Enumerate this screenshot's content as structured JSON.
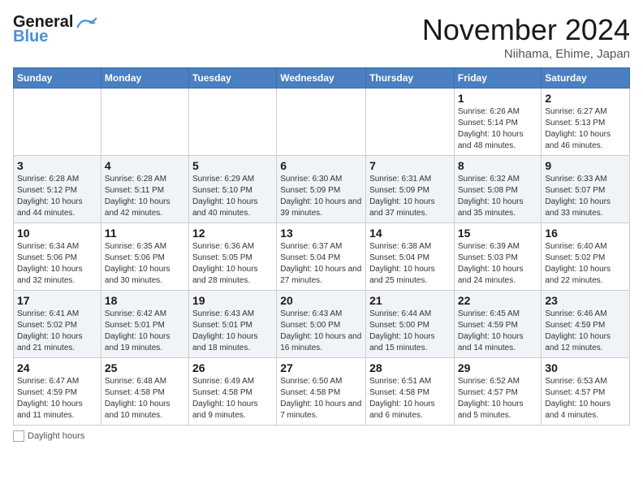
{
  "header": {
    "logo_general": "General",
    "logo_blue": "Blue",
    "month_title": "November 2024",
    "location": "Niihama, Ehime, Japan"
  },
  "weekdays": [
    "Sunday",
    "Monday",
    "Tuesday",
    "Wednesday",
    "Thursday",
    "Friday",
    "Saturday"
  ],
  "weeks": [
    [
      {
        "day": "",
        "info": ""
      },
      {
        "day": "",
        "info": ""
      },
      {
        "day": "",
        "info": ""
      },
      {
        "day": "",
        "info": ""
      },
      {
        "day": "",
        "info": ""
      },
      {
        "day": "1",
        "info": "Sunrise: 6:26 AM\nSunset: 5:14 PM\nDaylight: 10 hours and 48 minutes."
      },
      {
        "day": "2",
        "info": "Sunrise: 6:27 AM\nSunset: 5:13 PM\nDaylight: 10 hours and 46 minutes."
      }
    ],
    [
      {
        "day": "3",
        "info": "Sunrise: 6:28 AM\nSunset: 5:12 PM\nDaylight: 10 hours and 44 minutes."
      },
      {
        "day": "4",
        "info": "Sunrise: 6:28 AM\nSunset: 5:11 PM\nDaylight: 10 hours and 42 minutes."
      },
      {
        "day": "5",
        "info": "Sunrise: 6:29 AM\nSunset: 5:10 PM\nDaylight: 10 hours and 40 minutes."
      },
      {
        "day": "6",
        "info": "Sunrise: 6:30 AM\nSunset: 5:09 PM\nDaylight: 10 hours and 39 minutes."
      },
      {
        "day": "7",
        "info": "Sunrise: 6:31 AM\nSunset: 5:09 PM\nDaylight: 10 hours and 37 minutes."
      },
      {
        "day": "8",
        "info": "Sunrise: 6:32 AM\nSunset: 5:08 PM\nDaylight: 10 hours and 35 minutes."
      },
      {
        "day": "9",
        "info": "Sunrise: 6:33 AM\nSunset: 5:07 PM\nDaylight: 10 hours and 33 minutes."
      }
    ],
    [
      {
        "day": "10",
        "info": "Sunrise: 6:34 AM\nSunset: 5:06 PM\nDaylight: 10 hours and 32 minutes."
      },
      {
        "day": "11",
        "info": "Sunrise: 6:35 AM\nSunset: 5:06 PM\nDaylight: 10 hours and 30 minutes."
      },
      {
        "day": "12",
        "info": "Sunrise: 6:36 AM\nSunset: 5:05 PM\nDaylight: 10 hours and 28 minutes."
      },
      {
        "day": "13",
        "info": "Sunrise: 6:37 AM\nSunset: 5:04 PM\nDaylight: 10 hours and 27 minutes."
      },
      {
        "day": "14",
        "info": "Sunrise: 6:38 AM\nSunset: 5:04 PM\nDaylight: 10 hours and 25 minutes."
      },
      {
        "day": "15",
        "info": "Sunrise: 6:39 AM\nSunset: 5:03 PM\nDaylight: 10 hours and 24 minutes."
      },
      {
        "day": "16",
        "info": "Sunrise: 6:40 AM\nSunset: 5:02 PM\nDaylight: 10 hours and 22 minutes."
      }
    ],
    [
      {
        "day": "17",
        "info": "Sunrise: 6:41 AM\nSunset: 5:02 PM\nDaylight: 10 hours and 21 minutes."
      },
      {
        "day": "18",
        "info": "Sunrise: 6:42 AM\nSunset: 5:01 PM\nDaylight: 10 hours and 19 minutes."
      },
      {
        "day": "19",
        "info": "Sunrise: 6:43 AM\nSunset: 5:01 PM\nDaylight: 10 hours and 18 minutes."
      },
      {
        "day": "20",
        "info": "Sunrise: 6:43 AM\nSunset: 5:00 PM\nDaylight: 10 hours and 16 minutes."
      },
      {
        "day": "21",
        "info": "Sunrise: 6:44 AM\nSunset: 5:00 PM\nDaylight: 10 hours and 15 minutes."
      },
      {
        "day": "22",
        "info": "Sunrise: 6:45 AM\nSunset: 4:59 PM\nDaylight: 10 hours and 14 minutes."
      },
      {
        "day": "23",
        "info": "Sunrise: 6:46 AM\nSunset: 4:59 PM\nDaylight: 10 hours and 12 minutes."
      }
    ],
    [
      {
        "day": "24",
        "info": "Sunrise: 6:47 AM\nSunset: 4:59 PM\nDaylight: 10 hours and 11 minutes."
      },
      {
        "day": "25",
        "info": "Sunrise: 6:48 AM\nSunset: 4:58 PM\nDaylight: 10 hours and 10 minutes."
      },
      {
        "day": "26",
        "info": "Sunrise: 6:49 AM\nSunset: 4:58 PM\nDaylight: 10 hours and 9 minutes."
      },
      {
        "day": "27",
        "info": "Sunrise: 6:50 AM\nSunset: 4:58 PM\nDaylight: 10 hours and 7 minutes."
      },
      {
        "day": "28",
        "info": "Sunrise: 6:51 AM\nSunset: 4:58 PM\nDaylight: 10 hours and 6 minutes."
      },
      {
        "day": "29",
        "info": "Sunrise: 6:52 AM\nSunset: 4:57 PM\nDaylight: 10 hours and 5 minutes."
      },
      {
        "day": "30",
        "info": "Sunrise: 6:53 AM\nSunset: 4:57 PM\nDaylight: 10 hours and 4 minutes."
      }
    ]
  ],
  "footer": {
    "daylight_label": "Daylight hours"
  }
}
